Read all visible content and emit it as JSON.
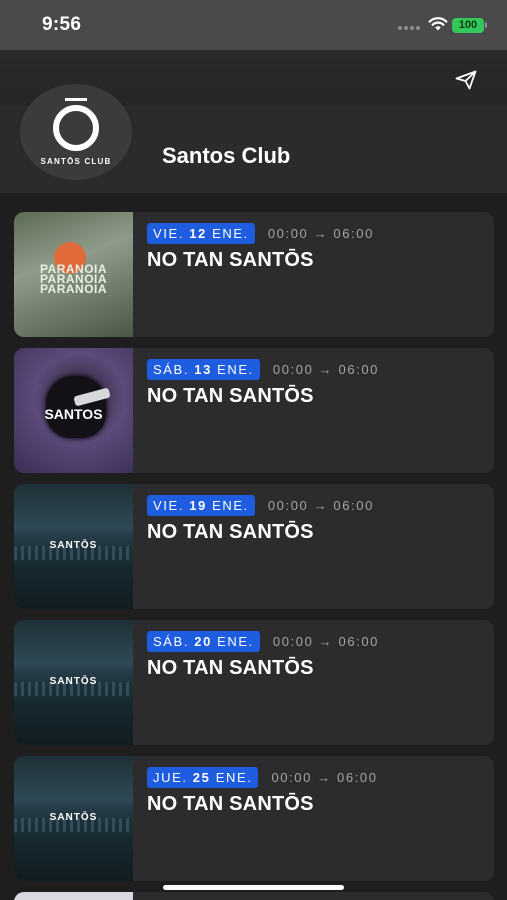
{
  "status_bar": {
    "time": "9:56",
    "battery": "100"
  },
  "header": {
    "club_name": "Santos Club",
    "logo_text": "SANTŌS CLUB"
  },
  "events": [
    {
      "weekday": "VIE.",
      "day": "12",
      "month": "ENE.",
      "time_start": "00:00",
      "time_end": "06:00",
      "title": "NO TAN SANTŌS",
      "poster": "PARANOIA"
    },
    {
      "weekday": "SÁB.",
      "day": "13",
      "month": "ENE.",
      "time_start": "00:00",
      "time_end": "06:00",
      "title": "NO TAN SANTŌS",
      "poster": "SANTOS"
    },
    {
      "weekday": "VIE.",
      "day": "19",
      "month": "ENE.",
      "time_start": "00:00",
      "time_end": "06:00",
      "title": "NO TAN SANTŌS",
      "poster": "SANTŌS"
    },
    {
      "weekday": "SÁB.",
      "day": "20",
      "month": "ENE.",
      "time_start": "00:00",
      "time_end": "06:00",
      "title": "NO TAN SANTŌS",
      "poster": "SANTŌS"
    },
    {
      "weekday": "JUE.",
      "day": "25",
      "month": "ENE.",
      "time_start": "00:00",
      "time_end": "06:00",
      "title": "NO TAN SANTŌS",
      "poster": "SANTŌS"
    }
  ],
  "time_arrow": "→",
  "colors": {
    "date_badge": "#1f5de0",
    "background": "#1e1e1f",
    "card": "#2c2c2e",
    "battery": "#34c759"
  }
}
